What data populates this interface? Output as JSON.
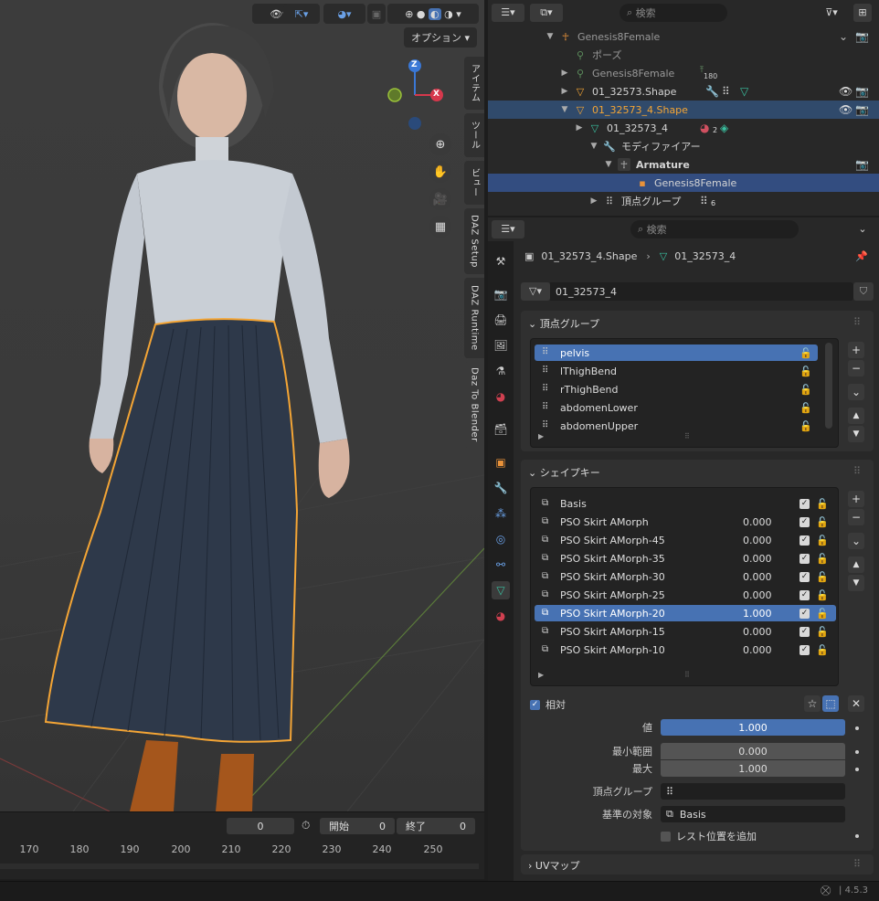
{
  "viewport": {
    "options_label": "オプション",
    "npanel_tabs": [
      "アイテム",
      "ツール",
      "ビュー",
      "DAZ Setup",
      "DAZ Runtime",
      "Daz To Blender"
    ],
    "gizmo": {
      "z": "Z",
      "x": "X"
    }
  },
  "timeline": {
    "current_frame": "0",
    "start_label": "開始",
    "start_value": "0",
    "end_label": "終了",
    "end_value": "0",
    "ticks": [
      "170",
      "180",
      "190",
      "200",
      "210",
      "220",
      "230",
      "240",
      "250"
    ]
  },
  "outliner": {
    "search_placeholder": "検索",
    "rows": [
      {
        "label": "Genesis8Female",
        "indent": 0
      },
      {
        "label": "ポーズ",
        "indent": 1
      },
      {
        "label": "Genesis8Female",
        "indent": 1,
        "badge": "180"
      },
      {
        "label": "01_32573.Shape",
        "indent": 1
      },
      {
        "label": "01_32573_4.Shape",
        "indent": 1
      },
      {
        "label": "01_32573_4",
        "indent": 2,
        "badge": "2"
      },
      {
        "label": "モディファイアー",
        "indent": 2
      },
      {
        "label": "Armature",
        "indent": 3
      },
      {
        "label": "Genesis8Female",
        "indent": 4
      },
      {
        "label": "頂点グループ",
        "indent": 2,
        "badge": "6"
      }
    ]
  },
  "properties": {
    "search_placeholder": "検索",
    "breadcrumb": {
      "object": "01_32573_4.Shape",
      "mesh": "01_32573_4"
    },
    "mesh_name": "01_32573_4",
    "vertex_groups": {
      "title": "頂点グループ",
      "items": [
        "pelvis",
        "lThighBend",
        "rThighBend",
        "abdomenLower",
        "abdomenUpper"
      ]
    },
    "shape_keys": {
      "title": "シェイプキー",
      "items": [
        {
          "name": "Basis",
          "value": ""
        },
        {
          "name": "PSO Skirt AMorph",
          "value": "0.000"
        },
        {
          "name": "PSO Skirt AMorph-45",
          "value": "0.000"
        },
        {
          "name": "PSO Skirt AMorph-35",
          "value": "0.000"
        },
        {
          "name": "PSO Skirt AMorph-30",
          "value": "0.000"
        },
        {
          "name": "PSO Skirt AMorph-25",
          "value": "0.000"
        },
        {
          "name": "PSO Skirt AMorph-20",
          "value": "1.000"
        },
        {
          "name": "PSO Skirt AMorph-15",
          "value": "0.000"
        },
        {
          "name": "PSO Skirt AMorph-10",
          "value": "0.000"
        }
      ],
      "relative_label": "相対",
      "value_label": "値",
      "value": "1.000",
      "min_label": "最小範囲",
      "min": "0.000",
      "max_label": "最大",
      "max": "1.000",
      "vgroup_label": "頂点グループ",
      "relative_to_label": "基準の対象",
      "relative_to": "Basis",
      "rest_label": "レスト位置を追加"
    },
    "uv_title": "UVマップ"
  },
  "statusbar": {
    "version": "4.5.3"
  },
  "colors": {
    "accent": "#4772b3",
    "selected_orange": "#f4a535",
    "bg": "#282828"
  }
}
